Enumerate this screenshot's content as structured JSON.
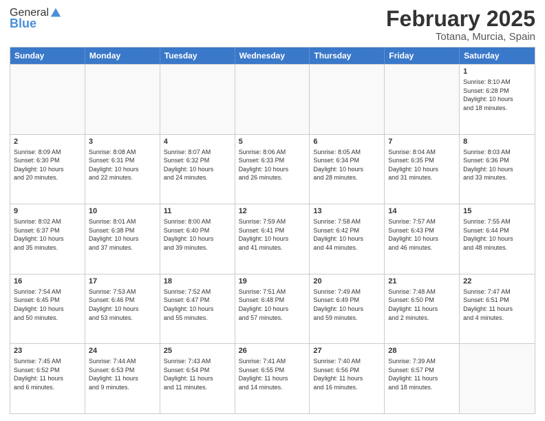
{
  "header": {
    "logo_general": "General",
    "logo_blue": "Blue",
    "month_year": "February 2025",
    "location": "Totana, Murcia, Spain"
  },
  "days_of_week": [
    "Sunday",
    "Monday",
    "Tuesday",
    "Wednesday",
    "Thursday",
    "Friday",
    "Saturday"
  ],
  "rows": [
    [
      {
        "day": "",
        "info": ""
      },
      {
        "day": "",
        "info": ""
      },
      {
        "day": "",
        "info": ""
      },
      {
        "day": "",
        "info": ""
      },
      {
        "day": "",
        "info": ""
      },
      {
        "day": "",
        "info": ""
      },
      {
        "day": "1",
        "info": "Sunrise: 8:10 AM\nSunset: 6:28 PM\nDaylight: 10 hours\nand 18 minutes."
      }
    ],
    [
      {
        "day": "2",
        "info": "Sunrise: 8:09 AM\nSunset: 6:30 PM\nDaylight: 10 hours\nand 20 minutes."
      },
      {
        "day": "3",
        "info": "Sunrise: 8:08 AM\nSunset: 6:31 PM\nDaylight: 10 hours\nand 22 minutes."
      },
      {
        "day": "4",
        "info": "Sunrise: 8:07 AM\nSunset: 6:32 PM\nDaylight: 10 hours\nand 24 minutes."
      },
      {
        "day": "5",
        "info": "Sunrise: 8:06 AM\nSunset: 6:33 PM\nDaylight: 10 hours\nand 26 minutes."
      },
      {
        "day": "6",
        "info": "Sunrise: 8:05 AM\nSunset: 6:34 PM\nDaylight: 10 hours\nand 28 minutes."
      },
      {
        "day": "7",
        "info": "Sunrise: 8:04 AM\nSunset: 6:35 PM\nDaylight: 10 hours\nand 31 minutes."
      },
      {
        "day": "8",
        "info": "Sunrise: 8:03 AM\nSunset: 6:36 PM\nDaylight: 10 hours\nand 33 minutes."
      }
    ],
    [
      {
        "day": "9",
        "info": "Sunrise: 8:02 AM\nSunset: 6:37 PM\nDaylight: 10 hours\nand 35 minutes."
      },
      {
        "day": "10",
        "info": "Sunrise: 8:01 AM\nSunset: 6:38 PM\nDaylight: 10 hours\nand 37 minutes."
      },
      {
        "day": "11",
        "info": "Sunrise: 8:00 AM\nSunset: 6:40 PM\nDaylight: 10 hours\nand 39 minutes."
      },
      {
        "day": "12",
        "info": "Sunrise: 7:59 AM\nSunset: 6:41 PM\nDaylight: 10 hours\nand 41 minutes."
      },
      {
        "day": "13",
        "info": "Sunrise: 7:58 AM\nSunset: 6:42 PM\nDaylight: 10 hours\nand 44 minutes."
      },
      {
        "day": "14",
        "info": "Sunrise: 7:57 AM\nSunset: 6:43 PM\nDaylight: 10 hours\nand 46 minutes."
      },
      {
        "day": "15",
        "info": "Sunrise: 7:55 AM\nSunset: 6:44 PM\nDaylight: 10 hours\nand 48 minutes."
      }
    ],
    [
      {
        "day": "16",
        "info": "Sunrise: 7:54 AM\nSunset: 6:45 PM\nDaylight: 10 hours\nand 50 minutes."
      },
      {
        "day": "17",
        "info": "Sunrise: 7:53 AM\nSunset: 6:46 PM\nDaylight: 10 hours\nand 53 minutes."
      },
      {
        "day": "18",
        "info": "Sunrise: 7:52 AM\nSunset: 6:47 PM\nDaylight: 10 hours\nand 55 minutes."
      },
      {
        "day": "19",
        "info": "Sunrise: 7:51 AM\nSunset: 6:48 PM\nDaylight: 10 hours\nand 57 minutes."
      },
      {
        "day": "20",
        "info": "Sunrise: 7:49 AM\nSunset: 6:49 PM\nDaylight: 10 hours\nand 59 minutes."
      },
      {
        "day": "21",
        "info": "Sunrise: 7:48 AM\nSunset: 6:50 PM\nDaylight: 11 hours\nand 2 minutes."
      },
      {
        "day": "22",
        "info": "Sunrise: 7:47 AM\nSunset: 6:51 PM\nDaylight: 11 hours\nand 4 minutes."
      }
    ],
    [
      {
        "day": "23",
        "info": "Sunrise: 7:45 AM\nSunset: 6:52 PM\nDaylight: 11 hours\nand 6 minutes."
      },
      {
        "day": "24",
        "info": "Sunrise: 7:44 AM\nSunset: 6:53 PM\nDaylight: 11 hours\nand 9 minutes."
      },
      {
        "day": "25",
        "info": "Sunrise: 7:43 AM\nSunset: 6:54 PM\nDaylight: 11 hours\nand 11 minutes."
      },
      {
        "day": "26",
        "info": "Sunrise: 7:41 AM\nSunset: 6:55 PM\nDaylight: 11 hours\nand 14 minutes."
      },
      {
        "day": "27",
        "info": "Sunrise: 7:40 AM\nSunset: 6:56 PM\nDaylight: 11 hours\nand 16 minutes."
      },
      {
        "day": "28",
        "info": "Sunrise: 7:39 AM\nSunset: 6:57 PM\nDaylight: 11 hours\nand 18 minutes."
      },
      {
        "day": "",
        "info": ""
      }
    ]
  ]
}
